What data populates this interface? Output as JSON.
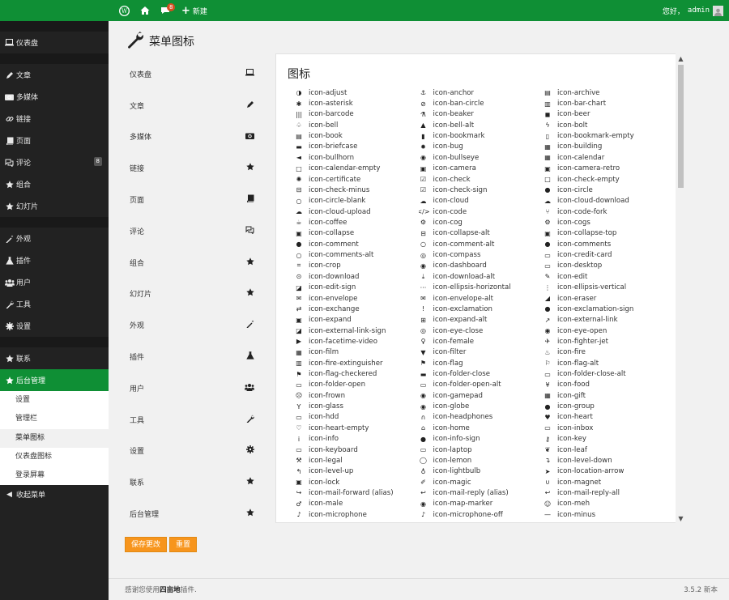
{
  "topbar": {
    "comments_badge": "8",
    "new_label": "新建",
    "greeting": "您好，",
    "username": "admin"
  },
  "sidebar": {
    "groups": [
      [
        {
          "icon": "laptop",
          "label": "仪表盘"
        }
      ],
      [
        {
          "icon": "pencil",
          "label": "文章"
        },
        {
          "icon": "camera",
          "label": "多媒体"
        },
        {
          "icon": "link",
          "label": "链接"
        },
        {
          "icon": "book",
          "label": "页面"
        },
        {
          "icon": "comments",
          "label": "评论",
          "count": "8"
        },
        {
          "icon": "star",
          "label": "组合"
        },
        {
          "icon": "star",
          "label": "幻灯片"
        }
      ],
      [
        {
          "icon": "magic",
          "label": "外观"
        },
        {
          "icon": "beaker",
          "label": "插件"
        },
        {
          "icon": "group",
          "label": "用户"
        },
        {
          "icon": "wrench",
          "label": "工具"
        },
        {
          "icon": "cog",
          "label": "设置"
        }
      ],
      [
        {
          "icon": "star",
          "label": "联系"
        },
        {
          "icon": "star",
          "label": "后台管理",
          "active": true
        }
      ]
    ],
    "submenu": [
      {
        "label": "设置"
      },
      {
        "label": "管理栏"
      },
      {
        "label": "菜单图标",
        "current": true
      },
      {
        "label": "仪表盘图标"
      },
      {
        "label": "登录屏幕"
      }
    ],
    "collapse_label": "收起菜单"
  },
  "page": {
    "title": "菜单图标"
  },
  "left_nav": [
    {
      "label": "仪表盘",
      "icon": "laptop"
    },
    {
      "label": "文章",
      "icon": "pencil"
    },
    {
      "label": "多媒体",
      "icon": "camera"
    },
    {
      "label": "链接",
      "icon": "star"
    },
    {
      "label": "页面",
      "icon": "book"
    },
    {
      "label": "评论",
      "icon": "comments"
    },
    {
      "label": "组合",
      "icon": "star"
    },
    {
      "label": "幻灯片",
      "icon": "star"
    },
    {
      "label": "外观",
      "icon": "magic"
    },
    {
      "label": "插件",
      "icon": "beaker"
    },
    {
      "label": "用户",
      "icon": "group"
    },
    {
      "label": "工具",
      "icon": "wrench"
    },
    {
      "label": "设置",
      "icon": "cog"
    },
    {
      "label": "联系",
      "icon": "star"
    },
    {
      "label": "后台管理",
      "icon": "star"
    }
  ],
  "icons_panel": {
    "title": "图标",
    "icons": [
      [
        "◑",
        "icon-adjust"
      ],
      [
        "⚓",
        "icon-anchor"
      ],
      [
        "▤",
        "icon-archive"
      ],
      [
        "✱",
        "icon-asterisk"
      ],
      [
        "⊘",
        "icon-ban-circle"
      ],
      [
        "▥",
        "icon-bar-chart"
      ],
      [
        "|||",
        "icon-barcode"
      ],
      [
        "⚗",
        "icon-beaker"
      ],
      [
        "◼",
        "icon-beer"
      ],
      [
        "♤",
        "icon-bell"
      ],
      [
        "▲",
        "icon-bell-alt"
      ],
      [
        "ϟ",
        "icon-bolt"
      ],
      [
        "▤",
        "icon-book"
      ],
      [
        "▮",
        "icon-bookmark"
      ],
      [
        "▯",
        "icon-bookmark-empty"
      ],
      [
        "▬",
        "icon-briefcase"
      ],
      [
        "✹",
        "icon-bug"
      ],
      [
        "▦",
        "icon-building"
      ],
      [
        "◄",
        "icon-bullhorn"
      ],
      [
        "◉",
        "icon-bullseye"
      ],
      [
        "▦",
        "icon-calendar"
      ],
      [
        "□",
        "icon-calendar-empty"
      ],
      [
        "▣",
        "icon-camera"
      ],
      [
        "▣",
        "icon-camera-retro"
      ],
      [
        "✺",
        "icon-certificate"
      ],
      [
        "☑",
        "icon-check"
      ],
      [
        "□",
        "icon-check-empty"
      ],
      [
        "⊟",
        "icon-check-minus"
      ],
      [
        "☑",
        "icon-check-sign"
      ],
      [
        "●",
        "icon-circle"
      ],
      [
        "○",
        "icon-circle-blank"
      ],
      [
        "☁",
        "icon-cloud"
      ],
      [
        "☁",
        "icon-cloud-download"
      ],
      [
        "☁",
        "icon-cloud-upload"
      ],
      [
        "</>",
        "icon-code"
      ],
      [
        "⑂",
        "icon-code-fork"
      ],
      [
        "☕",
        "icon-coffee"
      ],
      [
        "⚙",
        "icon-cog"
      ],
      [
        "⚙",
        "icon-cogs"
      ],
      [
        "▣",
        "icon-collapse"
      ],
      [
        "⊟",
        "icon-collapse-alt"
      ],
      [
        "▣",
        "icon-collapse-top"
      ],
      [
        "●",
        "icon-comment"
      ],
      [
        "○",
        "icon-comment-alt"
      ],
      [
        "●",
        "icon-comments"
      ],
      [
        "○",
        "icon-comments-alt"
      ],
      [
        "◎",
        "icon-compass"
      ],
      [
        "▭",
        "icon-credit-card"
      ],
      [
        "⌗",
        "icon-crop"
      ],
      [
        "◉",
        "icon-dashboard"
      ],
      [
        "▭",
        "icon-desktop"
      ],
      [
        "⊙",
        "icon-download"
      ],
      [
        "⤓",
        "icon-download-alt"
      ],
      [
        "✎",
        "icon-edit"
      ],
      [
        "◪",
        "icon-edit-sign"
      ],
      [
        "···",
        "icon-ellipsis-horizontal"
      ],
      [
        "⋮",
        "icon-ellipsis-vertical"
      ],
      [
        "✉",
        "icon-envelope"
      ],
      [
        "✉",
        "icon-envelope-alt"
      ],
      [
        "◢",
        "icon-eraser"
      ],
      [
        "⇄",
        "icon-exchange"
      ],
      [
        "!",
        "icon-exclamation"
      ],
      [
        "●",
        "icon-exclamation-sign"
      ],
      [
        "▣",
        "icon-expand"
      ],
      [
        "⊞",
        "icon-expand-alt"
      ],
      [
        "↗",
        "icon-external-link"
      ],
      [
        "◪",
        "icon-external-link-sign"
      ],
      [
        "◎",
        "icon-eye-close"
      ],
      [
        "◉",
        "icon-eye-open"
      ],
      [
        "▶",
        "icon-facetime-video"
      ],
      [
        "♀",
        "icon-female"
      ],
      [
        "✈",
        "icon-fighter-jet"
      ],
      [
        "▦",
        "icon-film"
      ],
      [
        "▼",
        "icon-filter"
      ],
      [
        "♨",
        "icon-fire"
      ],
      [
        "▥",
        "icon-fire-extinguisher"
      ],
      [
        "⚑",
        "icon-flag"
      ],
      [
        "⚐",
        "icon-flag-alt"
      ],
      [
        "⚑",
        "icon-flag-checkered"
      ],
      [
        "▬",
        "icon-folder-close"
      ],
      [
        "▭",
        "icon-folder-close-alt"
      ],
      [
        "▭",
        "icon-folder-open"
      ],
      [
        "▭",
        "icon-folder-open-alt"
      ],
      [
        "¥",
        "icon-food"
      ],
      [
        "☹",
        "icon-frown"
      ],
      [
        "◉",
        "icon-gamepad"
      ],
      [
        "▦",
        "icon-gift"
      ],
      [
        "Y",
        "icon-glass"
      ],
      [
        "◉",
        "icon-globe"
      ],
      [
        "●",
        "icon-group"
      ],
      [
        "▭",
        "icon-hdd"
      ],
      [
        "∩",
        "icon-headphones"
      ],
      [
        "♥",
        "icon-heart"
      ],
      [
        "♡",
        "icon-heart-empty"
      ],
      [
        "⌂",
        "icon-home"
      ],
      [
        "▭",
        "icon-inbox"
      ],
      [
        "i",
        "icon-info"
      ],
      [
        "●",
        "icon-info-sign"
      ],
      [
        "⚷",
        "icon-key"
      ],
      [
        "▭",
        "icon-keyboard"
      ],
      [
        "▭",
        "icon-laptop"
      ],
      [
        "❦",
        "icon-leaf"
      ],
      [
        "⚒",
        "icon-legal"
      ],
      [
        "◯",
        "icon-lemon"
      ],
      [
        "↴",
        "icon-level-down"
      ],
      [
        "↰",
        "icon-level-up"
      ],
      [
        "♁",
        "icon-lightbulb"
      ],
      [
        "➤",
        "icon-location-arrow"
      ],
      [
        "▣",
        "icon-lock"
      ],
      [
        "✐",
        "icon-magic"
      ],
      [
        "∪",
        "icon-magnet"
      ],
      [
        "↪",
        "icon-mail-forward (alias)"
      ],
      [
        "↩",
        "icon-mail-reply (alias)"
      ],
      [
        "↩",
        "icon-mail-reply-all"
      ],
      [
        "♂",
        "icon-male"
      ],
      [
        "◉",
        "icon-map-marker"
      ],
      [
        "☺",
        "icon-meh"
      ],
      [
        "♪",
        "icon-microphone"
      ],
      [
        "♪",
        "icon-microphone-off"
      ],
      [
        "—",
        "icon-minus"
      ]
    ]
  },
  "buttons": {
    "save": "保存更改",
    "reset": "重置"
  },
  "footer": {
    "prefix": "感谢您使用",
    "brand": "四亩地",
    "suffix": "插件.",
    "version": "3.5.2 新本"
  }
}
